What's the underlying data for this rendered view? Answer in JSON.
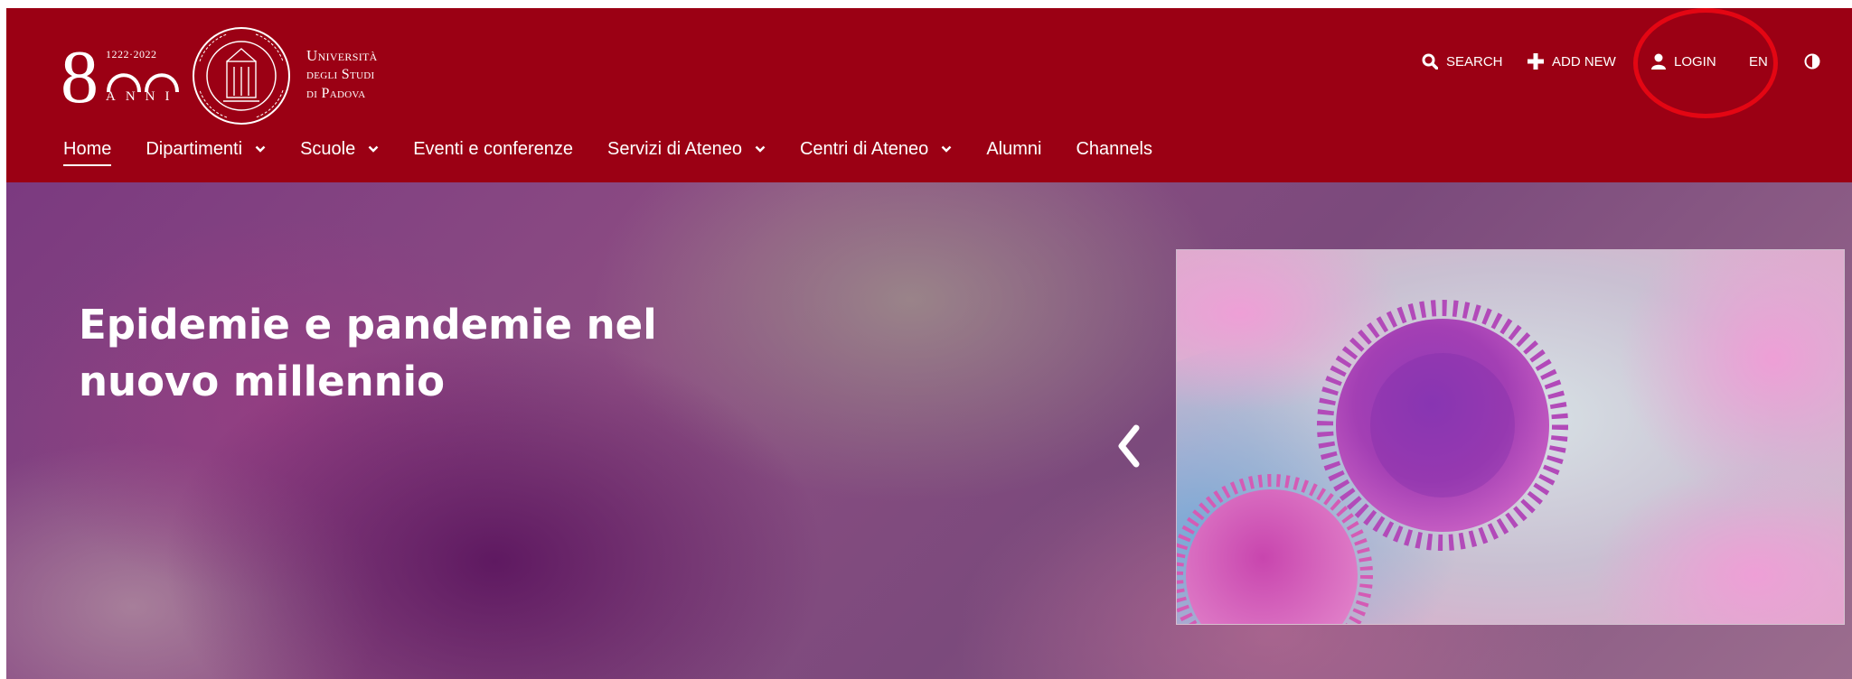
{
  "logo": {
    "numeral": "800",
    "years": "1222·2022",
    "anni": "ANNI",
    "university_line1": "Università",
    "university_line2": "degli Studi",
    "university_line3": "di Padova"
  },
  "utility": {
    "search_label": "SEARCH",
    "add_new_label": "ADD NEW",
    "login_label": "LOGIN",
    "language_label": "EN",
    "search_icon": "search-icon",
    "add_icon": "plus-icon",
    "login_icon": "user-icon",
    "contrast_icon": "contrast-icon"
  },
  "nav": {
    "items": [
      {
        "label": "Home",
        "active": true,
        "has_dropdown": false
      },
      {
        "label": "Dipartimenti",
        "active": false,
        "has_dropdown": true
      },
      {
        "label": "Scuole",
        "active": false,
        "has_dropdown": true
      },
      {
        "label": "Eventi e conferenze",
        "active": false,
        "has_dropdown": false
      },
      {
        "label": "Servizi di Ateneo",
        "active": false,
        "has_dropdown": true
      },
      {
        "label": "Centri di Ateneo",
        "active": false,
        "has_dropdown": true
      },
      {
        "label": "Alumni",
        "active": false,
        "has_dropdown": false
      },
      {
        "label": "Channels",
        "active": false,
        "has_dropdown": false
      }
    ]
  },
  "hero": {
    "title": "Epidemie e pandemie nel nuovo millennio",
    "prev_icon": "chevron-left-icon",
    "image_subject": "virus-illustration"
  },
  "colors": {
    "brand": "#9b0014",
    "annotation": "#e30613",
    "text": "#ffffff"
  }
}
